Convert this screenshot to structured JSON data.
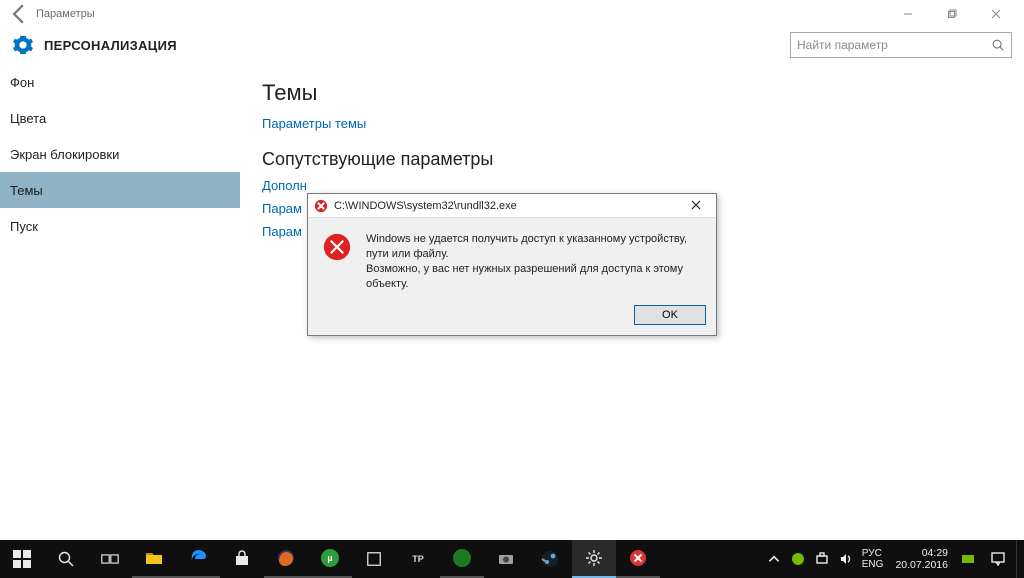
{
  "window": {
    "title": "Параметры",
    "category": "ПЕРСОНАЛИЗАЦИЯ",
    "search_placeholder": "Найти параметр"
  },
  "sidebar": {
    "items": [
      {
        "label": "Фон"
      },
      {
        "label": "Цвета"
      },
      {
        "label": "Экран блокировки"
      },
      {
        "label": "Темы"
      },
      {
        "label": "Пуск"
      }
    ],
    "selected_index": 3
  },
  "content": {
    "section1_title": "Темы",
    "section1_link": "Параметры темы",
    "section2_title": "Сопутствующие параметры",
    "related_links": [
      "Дополн",
      "Парам",
      "Парам"
    ]
  },
  "dialog": {
    "title": "C:\\WINDOWS\\system32\\rundll32.exe",
    "line1": "Windows не удается получить доступ к указанному устройству, пути или файлу.",
    "line2": "Возможно, у вас нет нужных разрешений для доступа к этому объекту.",
    "ok": "OK"
  },
  "taskbar": {
    "lang1": "РУС",
    "lang2": "ENG",
    "time": "04:29",
    "date": "20.07.2016",
    "labels": {
      "tp": "TP"
    }
  }
}
